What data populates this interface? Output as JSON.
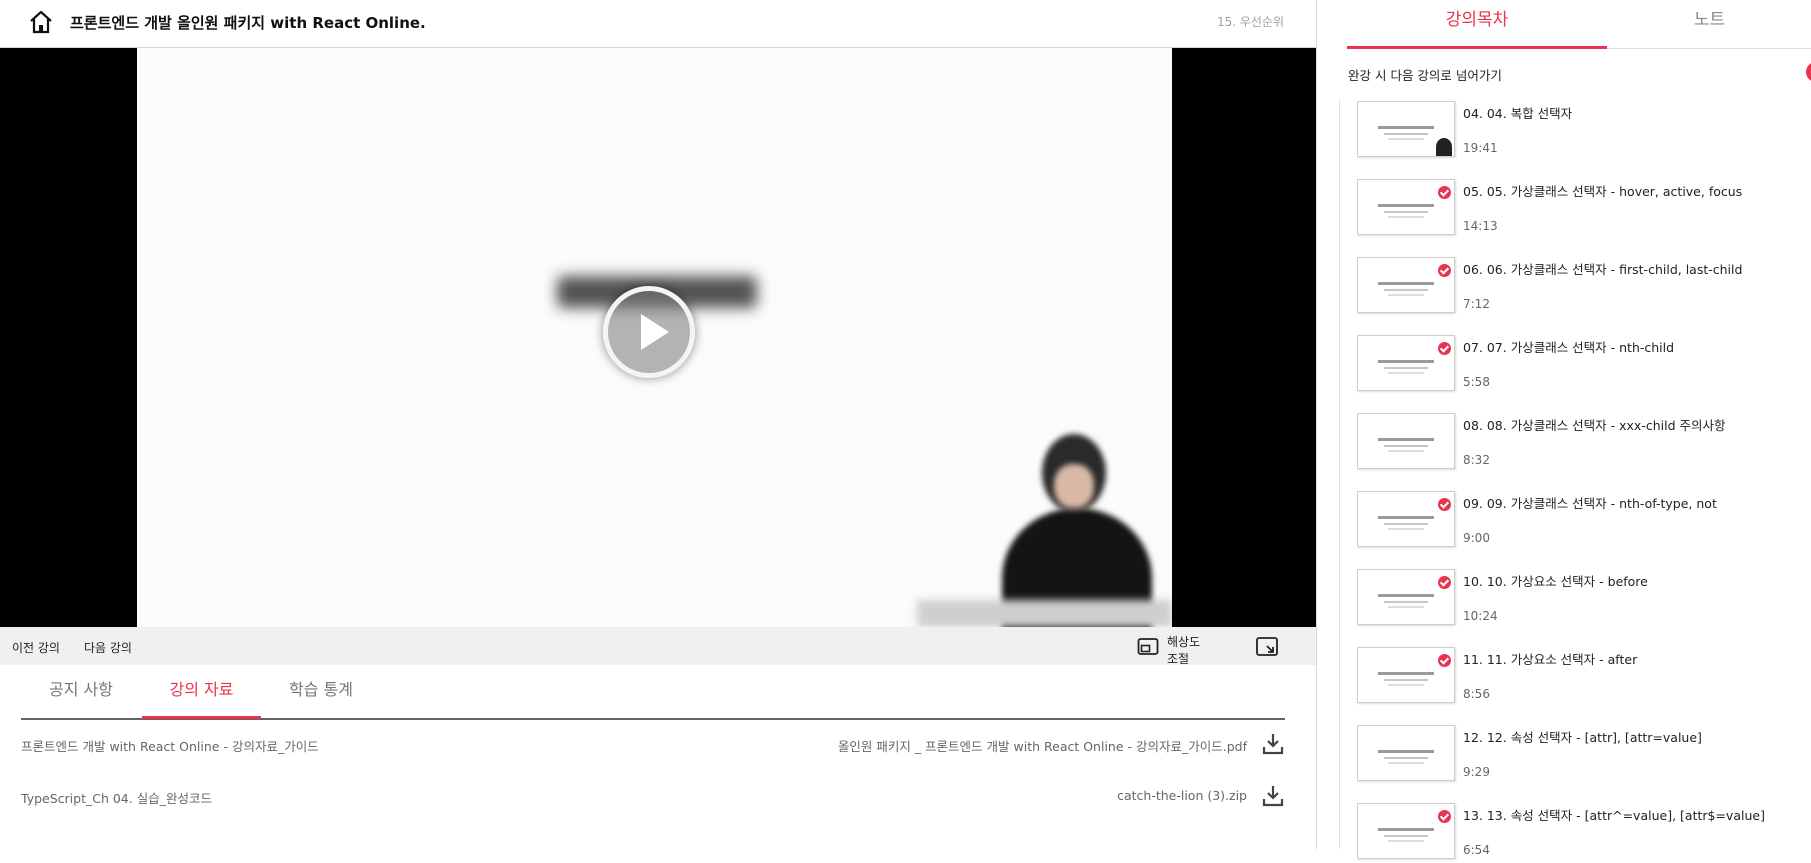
{
  "header": {
    "course_title": "프론트엔드 개발 올인원 패키지 with React Online.",
    "current_lecture": "15. 우선순위"
  },
  "controls": {
    "prev_label": "이전 강의",
    "next_label": "다음 강의",
    "resolution_label": "해상도\n조절"
  },
  "tabs": [
    {
      "label": "공지 사항",
      "active": false
    },
    {
      "label": "강의 자료",
      "active": true
    },
    {
      "label": "학습 통계",
      "active": false
    }
  ],
  "materials": [
    {
      "name": "프론트엔드 개발 with React Online - 강의자료_가이드",
      "file": "올인원 패키지 _ 프론트엔드 개발 with React Online - 강의자료_가이드.pdf"
    },
    {
      "name": "TypeScript_Ch 04. 실습_완성코드",
      "file": "catch-the-lion (3).zip"
    }
  ],
  "sidebar": {
    "tab_toc": "강의목차",
    "tab_note": "노트",
    "autoplay_label": "완강 시 다음 강의로 넘어가기",
    "lessons": [
      {
        "title": "04. 04. 복합 선택자",
        "duration": "19:41",
        "completed": false
      },
      {
        "title": "05. 05. 가상클래스 선택자 - hover, active, focus",
        "duration": "14:13",
        "completed": true
      },
      {
        "title": "06. 06. 가상클래스 선택자 - first-child, last-child",
        "duration": "7:12",
        "completed": true
      },
      {
        "title": "07. 07. 가상클래스 선택자 - nth-child",
        "duration": "5:58",
        "completed": true
      },
      {
        "title": "08. 08. 가상클래스 선택자 - xxx-child 주의사항",
        "duration": "8:32",
        "completed": false
      },
      {
        "title": "09. 09. 가상클래스 선택자 - nth-of-type, not",
        "duration": "9:00",
        "completed": true
      },
      {
        "title": "10. 10. 가상요소 선택자 - before",
        "duration": "10:24",
        "completed": true
      },
      {
        "title": "11. 11. 가상요소 선택자 - after",
        "duration": "8:56",
        "completed": true
      },
      {
        "title": "12. 12. 속성 선택자 - [attr], [attr=value]",
        "duration": "9:29",
        "completed": false
      },
      {
        "title": "13. 13. 속성 선택자 - [attr^=value], [attr$=value]",
        "duration": "6:54",
        "completed": true
      }
    ]
  },
  "colors": {
    "accent": "#e8344e",
    "video_bg": "#000000",
    "control_bar": "#f0f0f0"
  }
}
